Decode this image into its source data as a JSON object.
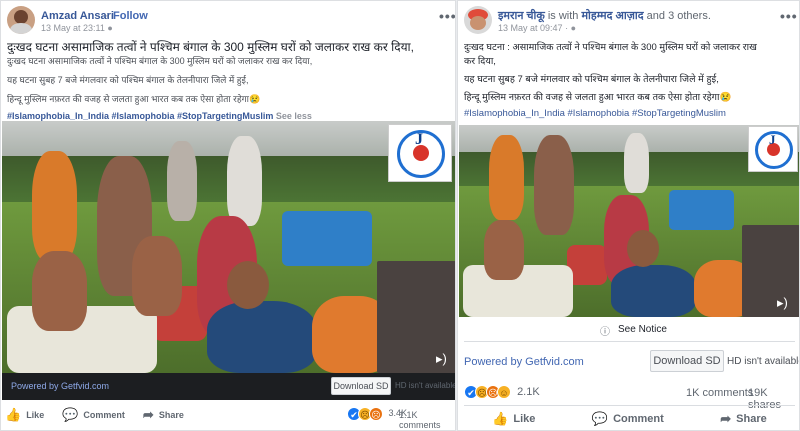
{
  "left": {
    "name": "Amzad Ansari",
    "follow": "Follow",
    "timestamp": "13 May at 23:11",
    "separator": "·",
    "headline": "दुःखद घटना असामाजिक तत्वों ने पश्चिम बंगाल के 300 मुस्लिम घरों को जलाकर राख कर दिया,",
    "translation_line": "दुःखद घटना असामाजिक तत्वों ने पश्चिम बंगाल के 300 मुस्लिम घरों को जलाकर राख कर दिया,",
    "line2": "यह घटना सुबह 7 बजे मंगलवार को पश्चिम बंगाल के तेलनीपारा जिले में हुई,",
    "line3": "हिन्दू मुस्लिम नफ़रत की वजह से जलता हुआ भारत कब तक ऐसा होता रहेगा😢",
    "hashtags": "#Islamophobia_In_India #Islamophobia #StopTargetingMuslim",
    "see_less": "See less",
    "powered_by": "Powered by Getfvid.com",
    "download": "Download SD",
    "hd_note": "HD isn't available",
    "reaction_count": "3.4K",
    "comments": "1.1K comments",
    "actions": [
      "Like",
      "Comment",
      "Share"
    ]
  },
  "right": {
    "name": "इमरान चीकू",
    "with_text": "is with",
    "with_name": "मोहम्मद आज़ाद",
    "and_others": "and 3 others.",
    "timestamp": "13 May at 09:47",
    "separator": "·",
    "line1": "दुःखद घटना : असामाजिक तत्वों ने पश्चिम बंगाल के 300 मुस्लिम घरों को जलाकर राख",
    "line1b": "कर दिया,",
    "line2": "यह घटना सुबह 7 बजे मंगलवार को पश्चिम बंगाल के तेलनीपारा जिले में हुई,",
    "line3": "हिन्दू मुस्लिम नफ़रत की वजह से जलता हुआ भारत कब तक ऐसा होता रहेगा😢",
    "hashtags": "#Islamophobia_In_India #Islamophobia #StopTargetingMuslim",
    "see_notice": "See Notice",
    "powered_by": "Powered by Getfvid.com",
    "download": "Download SD",
    "hd_note": "HD isn't available",
    "reaction_count": "2.1K",
    "comments": "1K comments",
    "shares": "19K shares",
    "actions": [
      "Like",
      "Comment",
      "Share"
    ]
  },
  "icons": {
    "more": "more-options-icon",
    "globe": "globe-icon",
    "volume": "volume-icon",
    "info": "info-icon",
    "like": "thumbs-up-icon",
    "comment": "comment-bubble-icon",
    "share": "share-arrow-icon"
  },
  "colors": {
    "brand_blue": "#385898",
    "link_blue": "#4267b2",
    "text": "#1d2129",
    "muted": "#90949c"
  }
}
